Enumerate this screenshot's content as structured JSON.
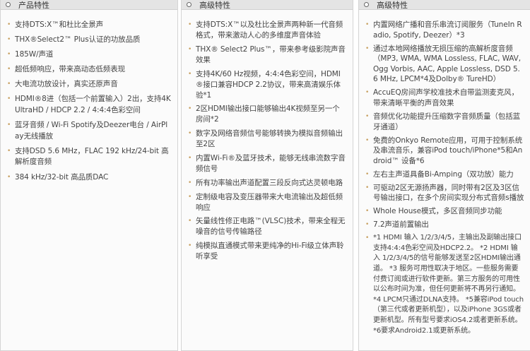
{
  "columns": [
    {
      "title": "产品特性",
      "items": [
        "支持DTS:X™和杜比全景声",
        "THX®Select2™ Plus认证的功放品质",
        "185W/声道",
        "超低频响应，带来高动态低频表现",
        "大电流功放设计，真实还原声音",
        "HDMI®8进（包括一个前置输入）2出，支持4K UltraHD / HDCP 2.2 / 4:4:4色彩空间",
        "蓝牙音频 / Wi-Fi Spotify及Deezer电台 / AirPlay无线播放",
        "支持DSD 5.6 MHz，FLAC 192 kHz/24-bit 高解析度音频",
        "384 kHz/32-bit 高品质DAC"
      ]
    },
    {
      "title": "高级特性",
      "items": [
        "支持DTS:X™以及杜比全景声两种新一代音频格式，带来激动人心的多维度声音体验",
        "THX® Select2 Plus™，带来参考级影院声音效果",
        "支持4K/60 Hz视频，4:4:4色彩空间，HDMI®接口兼容HDCP 2.2协议，带来高清娱乐体验*1",
        "2区HDMI输出接口能够输出4K视频至另一个房间*2",
        "数字及网络音频信号能够转换为模拟音频输出至2区",
        "内置Wi-Fi®及蓝牙技术，能够无线串流数字音频信号",
        "所有功率输出声道配置三段反向式达灵顿电路",
        "定制级电容及变压器带来大电流输出及超低频响应",
        "矢量线性修正电路™(VLSC)技术，带来全程无噪音的信号传输路径",
        "纯模拟直通模式带来更纯净的Hi-Fi级立体声聆听享受"
      ]
    },
    {
      "title": "高级特性",
      "items": [
        "内置网络广播和音乐串流订阅服务（TuneIn Radio, Spotify, Deezer）*3",
        "通过本地网络播放无损压缩的高解析度音频（MP3, WMA, WMA Lossless, FLAC, WAV, Ogg Vorbis, AAC, Apple Lossless, DSD 5.6 MHz, LPCM*4及Dolby® TureHD）",
        "AccuEQ房间声学校准技术自带监测麦克风，带来清晰平衡的声音效果",
        "音频优化功能提升压缩数字音频质量（包括蓝牙通道）",
        "免费的Onkyo Remote应用，可用于控制系统及串流音乐，兼容iPod touch/iPhone*5和Android™ 设备*6",
        "左右主声道具备Bi-Amping（双功放）能力",
        "可驱动2区无源扬声器，同时带有2区及3区信号输出接口，在多个房间实现分布式音频s播放",
        "Whole House模式，多区音频同步功能",
        "7.2声道前置输出",
        "*1 HDMI 输入 1/2/3/4/5，主输出及副输出接口支持4:4:4色彩空间及HDCP2.2。 *2 HDMI 输入 1/2/3/4/5的信号能够发送至2区HDMI输出通道。 *3 服务可用性取决于地区。一些服务需要付费订阅或进行软件更新。第三方服务的可用性以公布时间为准，但任何更新将不再另行通知。 *4 LPCM只通过DLNA支持。 *5兼容iPod touch（第三代或者更新机型），以及iPhone 3GS或者更新机型。所有型号要求iOS4.2或者更新系统。 *6要求Android2.1或更新系统。"
      ]
    }
  ]
}
